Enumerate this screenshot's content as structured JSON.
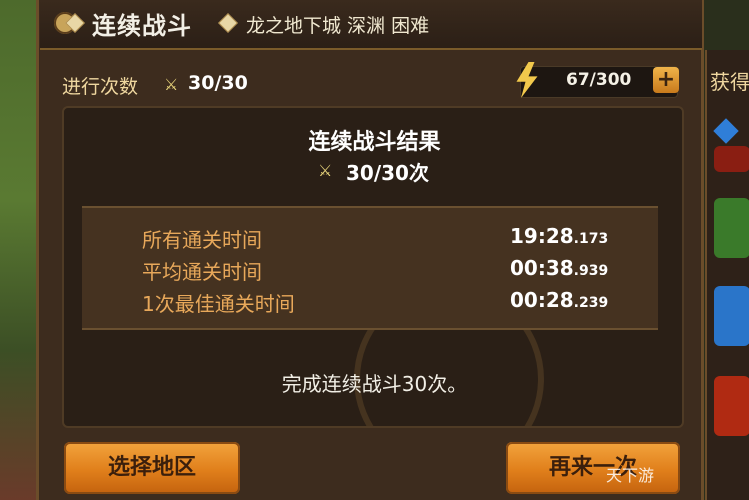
{
  "header": {
    "title": "连续战斗",
    "subtitle": "龙之地下城 深渊 困难"
  },
  "runs": {
    "label": "进行次数",
    "value": "30/30"
  },
  "energy": {
    "value": "67/300",
    "plus_label": "+"
  },
  "results": {
    "title": "连续战斗结果",
    "count": "30/30次",
    "times": [
      {
        "label": "所有通关时间",
        "value": "19:28",
        "ms": ".173"
      },
      {
        "label": "平均通关时间",
        "value": "00:38",
        "ms": ".939"
      },
      {
        "label": "1次最佳通关时间",
        "value": "00:28",
        "ms": ".239"
      }
    ],
    "complete_message": "完成连续战斗30次。"
  },
  "buttons": {
    "select_area": "选择地区",
    "retry": "再来一次"
  },
  "rewards": {
    "title": "获得"
  },
  "watermark": "天下游",
  "colors": {
    "accent_orange": "#e07f1b",
    "label_gold": "#e8a85a",
    "panel_bg": "#2a1f16"
  }
}
